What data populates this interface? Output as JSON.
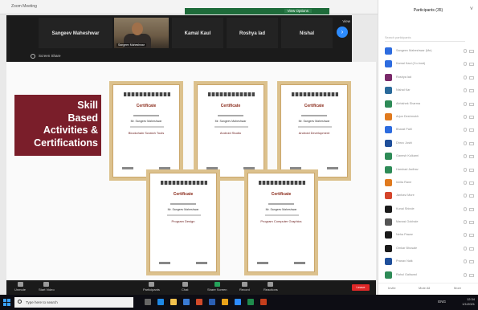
{
  "window": {
    "app_title": "Zoom Meeting",
    "view_options": "View Options"
  },
  "gallery": {
    "tiles": [
      {
        "name": "Sangeev Maheshwar"
      },
      {
        "name": "Sangeev Maheshwar",
        "video": true
      },
      {
        "name": "Kamal Kaul"
      },
      {
        "name": "Roshya lad"
      },
      {
        "name": "Nishal"
      }
    ],
    "view_label": "View"
  },
  "shared_bar": {
    "label": "Screen Share"
  },
  "slide": {
    "banner_lines": [
      "Skill",
      "Based",
      "Activities &",
      "Certifications"
    ],
    "certificates": [
      {
        "title": "Certificate",
        "name": "Mr. Sangeev Maheshwar",
        "activity": "Blockchain Scratch Tools"
      },
      {
        "title": "Certificate",
        "name": "Mr. Sangeev Maheshwar",
        "activity": "Android Studio"
      },
      {
        "title": "Certificate",
        "name": "Mr. Sangeev Maheshwar",
        "activity": "Android Development"
      },
      {
        "title": "Certificate",
        "name": "Mr. Sangeev Maheshwar",
        "activity": "Program Design"
      },
      {
        "title": "Certificate",
        "name": "Mr. Sangeev Maheshwar",
        "activity": "Program Computer Graphics"
      }
    ]
  },
  "controls": {
    "items": [
      "Unmute",
      "Start Video",
      "Participants",
      "Chat",
      "Share Screen",
      "Record",
      "Reactions"
    ],
    "end_label": "Leave"
  },
  "participants": {
    "title": "Participants (35)",
    "search_placeholder": "Search participants",
    "list": [
      {
        "name": "Sangeev Maheshwar (Me)",
        "color": "#2d6cdf"
      },
      {
        "name": "Kamal Kaul (Co-host)",
        "color": "#2d6cdf"
      },
      {
        "name": "Roshya lad",
        "color": "#7a2a6a"
      },
      {
        "name": "Nishal Kar",
        "color": "#2a6a9a"
      },
      {
        "name": "Abhishek Sharma",
        "color": "#2e8b57"
      },
      {
        "name": "Arjun Deshmukh",
        "color": "#e07a1e"
      },
      {
        "name": "Bharat Patil",
        "color": "#2d6cdf"
      },
      {
        "name": "Dhruv Joshi",
        "color": "#1f4f9a"
      },
      {
        "name": "Ganesh Kulkarni",
        "color": "#2e8b57"
      },
      {
        "name": "Harshad Jadhav",
        "color": "#2e8b57"
      },
      {
        "name": "Ishita Rane",
        "color": "#e07a1e"
      },
      {
        "name": "Janhavi More",
        "color": "#d4452b"
      },
      {
        "name": "Kunal Shinde",
        "color": "#1a1a1a"
      },
      {
        "name": "Manasi Gokhale",
        "color": "#555555"
      },
      {
        "name": "Neha Pawar",
        "color": "#1a1a1a"
      },
      {
        "name": "Omkar Bhosale",
        "color": "#1a1a1a"
      },
      {
        "name": "Pranav Naik",
        "color": "#1f4f9a"
      },
      {
        "name": "Rahul Gaikwad",
        "color": "#2e8b57"
      }
    ],
    "footer": [
      "Invite",
      "Mute All",
      "More"
    ]
  },
  "taskbar": {
    "search_placeholder": "Type here to search",
    "lang": "ENG",
    "time": "12:34",
    "date": "1/1/2021"
  }
}
